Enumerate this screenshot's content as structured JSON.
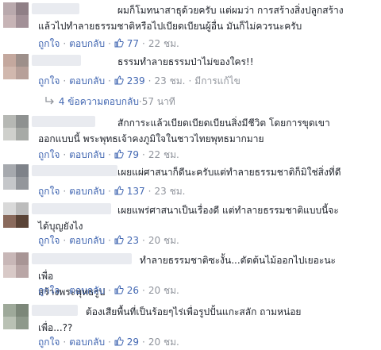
{
  "labels": {
    "like": "ถูกใจ",
    "reply": "ตอบกลับ",
    "sep": "·"
  },
  "comments": [
    {
      "text": "ผมก็โมทนาสาธุด้วยครับ แต่ผมว่า การสร้างสิ่งปลูกสร้าง\nแล้วไปทำลายธรรมชาติหรือไปเบียดเบียนผู้อื่น มันก็ไม่ควรนะครับ",
      "likes": "77",
      "time": "22 ชม.",
      "edited": "",
      "avatar": [
        "#b9a9ad",
        "#8f7f86",
        "#c7b4b6",
        "#a29097"
      ]
    },
    {
      "text": "ธรรมทำลายธรรมป่าไม่ของใคร!!",
      "likes": "239",
      "time": "23 ชม.",
      "edited": "มีการแก้ไข",
      "avatar": [
        "#c4a89e",
        "#9d8f8a",
        "#d1b8ae",
        "#b7a099"
      ]
    },
    {
      "text": "สักการะแล้วเบียดเบียดเบียนสิ่งมีชีวิต โดยการขุดเขา\nออกแบบนี้ พระพุทธเจ้าคงภูมิใจในชาวไทยพุทธมากมาย",
      "likes": "79",
      "time": "22 ชม.",
      "edited": "",
      "avatar": [
        "#b6b8b4",
        "#8e9190",
        "#cfd0cc",
        "#a7aaa6"
      ]
    },
    {
      "text": "เผยแผ่ศาสนาก็ดีนะครับแต่ทำลายธรรมชาติก็มิใช่สิ่งที่ดี",
      "likes": "137",
      "time": "23 ชม.",
      "edited": "",
      "avatar": [
        "#a6a9ae",
        "#7e8289",
        "#c5c7ca",
        "#93969b"
      ]
    },
    {
      "text": "เผยแพร่ศาสนาเป็นเรื่องดี แต่ทำลายธรรมชาติแบบนี้จะ\nได้บุญยังไง",
      "likes": "23",
      "time": "20 ชม.",
      "edited": "",
      "avatar": [
        "#d9d9d9",
        "#bcbcbc",
        "#8a6a5c",
        "#5a4336"
      ]
    },
    {
      "text": "ทำลายธรรมชาติซะงั้น...ตัดต้นไม้ออกไปเยอะนะเพื่อ\nสร้างพระพุทธรูป",
      "likes": "26",
      "time": "20 ชม.",
      "edited": "",
      "avatar": [
        "#c8b7b7",
        "#a89595",
        "#d8c9c7",
        "#b9a6a6"
      ]
    },
    {
      "text": "ต้องเสียพื้นที่เป็นร้อยๆไร่เพื่อรูปปั้นแกะสลัก ถามหน่อย\nเพื่อ...??",
      "likes": "29",
      "time": "20 ชม.",
      "edited": "",
      "avatar": [
        "#9ea99a",
        "#7c8779",
        "#b9c1b4",
        "#8e998b"
      ]
    }
  ],
  "reply_summary": {
    "text": "4 ข้อความตอบกลับ",
    "time": "57 นาที"
  }
}
